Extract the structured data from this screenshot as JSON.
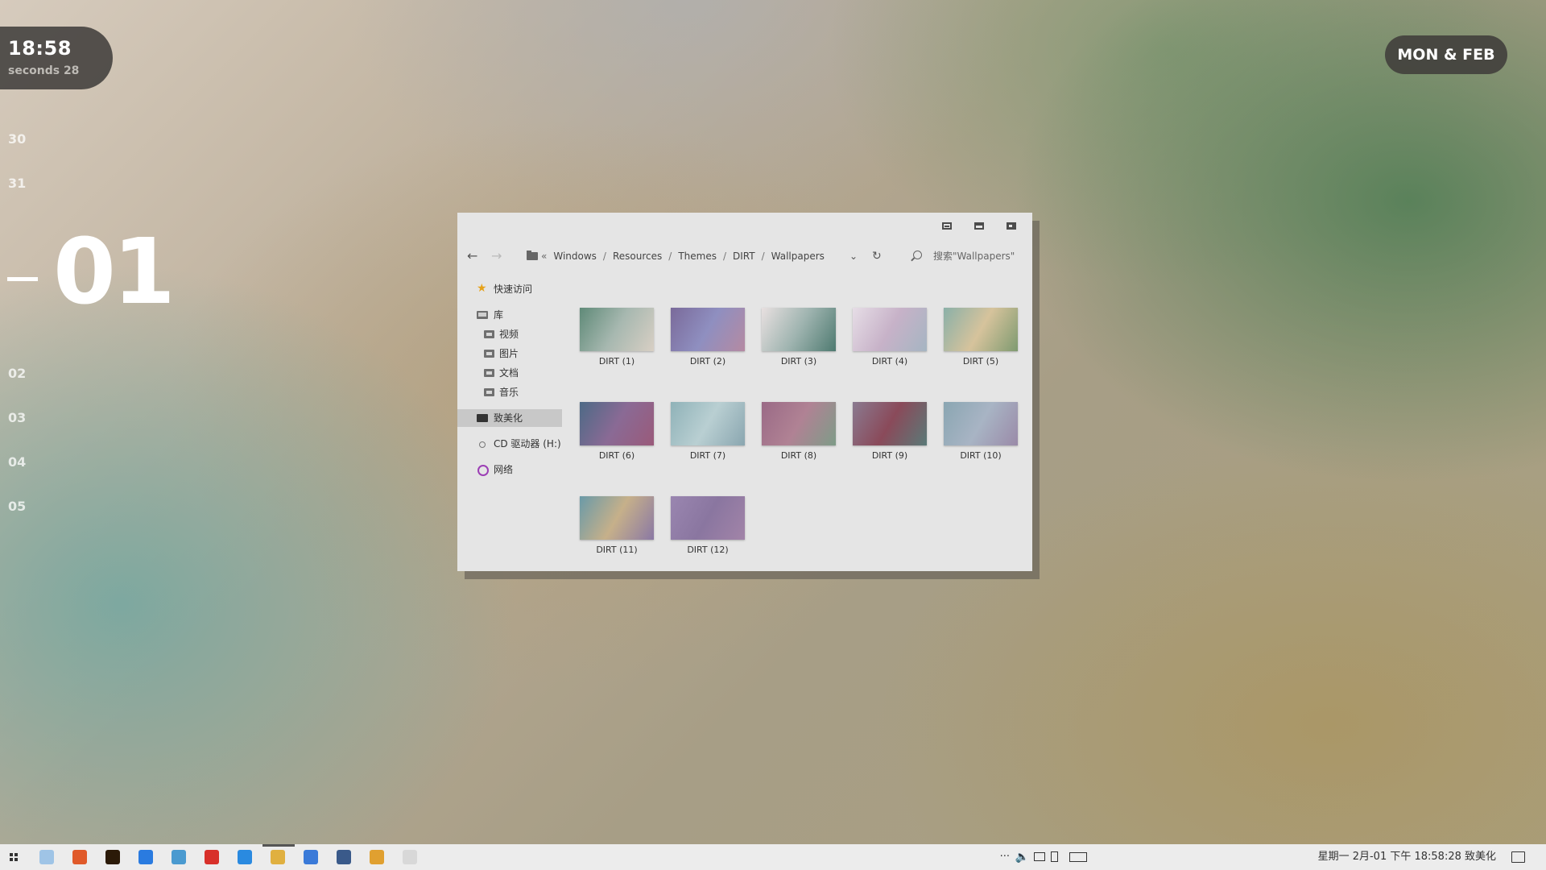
{
  "clock": {
    "time": "18:58",
    "seconds": "seconds 28"
  },
  "date_badge": "MON & FEB",
  "day_strip": {
    "before": [
      "30",
      "31"
    ],
    "current": "01",
    "after": [
      "02",
      "03",
      "04",
      "05"
    ]
  },
  "explorer": {
    "breadcrumb": {
      "chevron": "«",
      "items": [
        "Windows",
        "Resources",
        "Themes",
        "DIRT",
        "Wallpapers"
      ]
    },
    "search_placeholder": "搜索\"Wallpapers\"",
    "sidebar": {
      "quick_access": "快速访问",
      "library": "库",
      "library_items": [
        "视频",
        "图片",
        "文档",
        "音乐"
      ],
      "this_pc": "致美化",
      "cd_drive": "CD 驱动器 (H:)",
      "network": "网络"
    },
    "files": [
      {
        "name": "DIRT (1)",
        "colors": [
          "#5f8a78",
          "#a7b8b0",
          "#d8cfc4"
        ]
      },
      {
        "name": "DIRT (2)",
        "colors": [
          "#7a6a9a",
          "#8f8fc0",
          "#b58aa2"
        ]
      },
      {
        "name": "DIRT (3)",
        "colors": [
          "#e8e0e0",
          "#9fb4b0",
          "#4e7a70"
        ]
      },
      {
        "name": "DIRT (4)",
        "colors": [
          "#e6dde6",
          "#c7b2c8",
          "#a5b5c2"
        ]
      },
      {
        "name": "DIRT (5)",
        "colors": [
          "#8ab0a8",
          "#d6c39c",
          "#7e9a70"
        ]
      },
      {
        "name": "DIRT (6)",
        "colors": [
          "#4d6a86",
          "#8a6a95",
          "#9a5a7a"
        ]
      },
      {
        "name": "DIRT (7)",
        "colors": [
          "#8fb2b8",
          "#b9cfd2",
          "#8aa6b0"
        ]
      },
      {
        "name": "DIRT (8)",
        "colors": [
          "#9a6a86",
          "#b08294",
          "#7e9c88"
        ]
      },
      {
        "name": "DIRT (9)",
        "colors": [
          "#8a7a90",
          "#8a4a5a",
          "#5a7a78"
        ]
      },
      {
        "name": "DIRT (10)",
        "colors": [
          "#8aa6b2",
          "#a8b4c4",
          "#9a8aa8"
        ]
      },
      {
        "name": "DIRT (11)",
        "colors": [
          "#6a9aa8",
          "#c6b08a",
          "#8a78a4"
        ]
      },
      {
        "name": "DIRT (12)",
        "colors": [
          "#9a86b0",
          "#8a76a0",
          "#a284a8"
        ]
      }
    ]
  },
  "taskbar": {
    "apps": [
      {
        "name": "file-app-icon",
        "color": "#9fc4e6"
      },
      {
        "name": "office-icon",
        "color": "#e05a2a"
      },
      {
        "name": "illustrator-icon",
        "color": "#2b1a08"
      },
      {
        "name": "security-shield-icon",
        "color": "#2a7be0"
      },
      {
        "name": "mail-icon",
        "color": "#4a9ad0"
      },
      {
        "name": "music-app-icon",
        "color": "#d8302a"
      },
      {
        "name": "chat-app-icon",
        "color": "#2a8ae0"
      },
      {
        "name": "file-explorer-icon",
        "color": "#e0b040"
      },
      {
        "name": "notes-icon",
        "color": "#3a7ad8"
      },
      {
        "name": "calculator-icon",
        "color": "#3a5a8a"
      },
      {
        "name": "chrome-icon",
        "color": "#e0a030"
      },
      {
        "name": "font-app-icon",
        "color": "#d8d8d8"
      }
    ],
    "tray_overflow": "···",
    "datetime": "星期一 2月-01 下午 18:58:28 致美化"
  }
}
